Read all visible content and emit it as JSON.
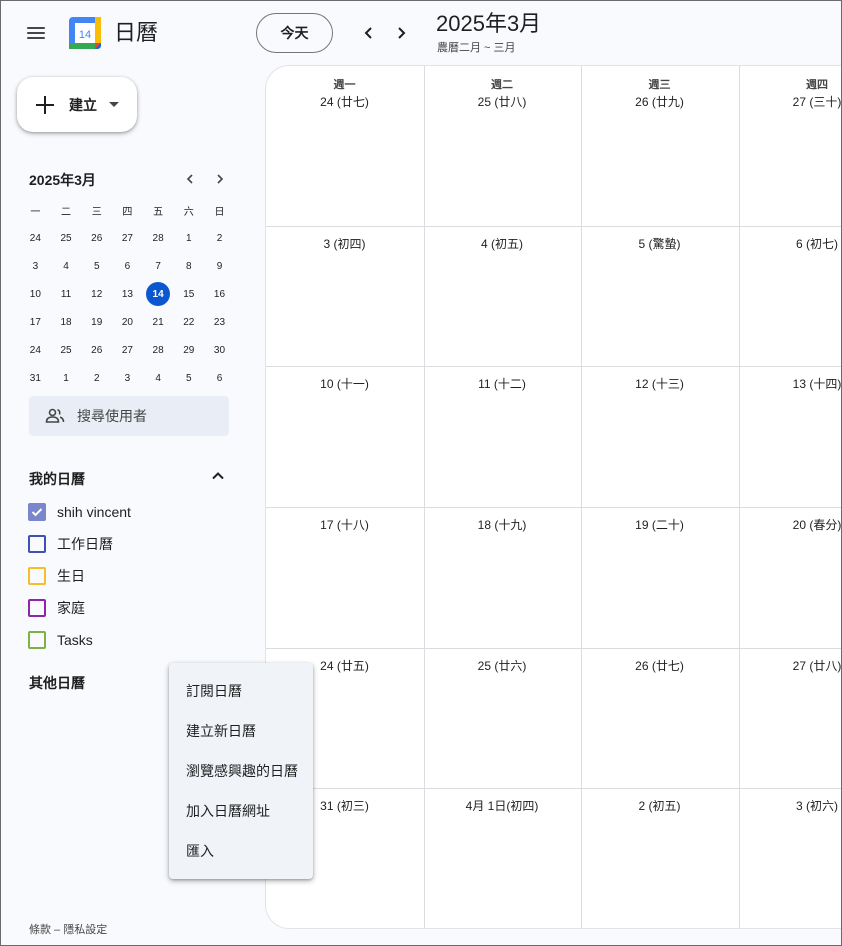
{
  "header": {
    "app_title": "日曆",
    "logo_number": "14",
    "today_button": "今天",
    "month_title": "2025年3月",
    "lunar_range": "農曆二月 ~ 三月"
  },
  "sidebar": {
    "create_label": "建立",
    "mini_calendar": {
      "title": "2025年3月",
      "weekdays": [
        "一",
        "二",
        "三",
        "四",
        "五",
        "六",
        "日"
      ],
      "weeks": [
        [
          "24",
          "25",
          "26",
          "27",
          "28",
          "1",
          "2"
        ],
        [
          "3",
          "4",
          "5",
          "6",
          "7",
          "8",
          "9"
        ],
        [
          "10",
          "11",
          "12",
          "13",
          "14",
          "15",
          "16"
        ],
        [
          "17",
          "18",
          "19",
          "20",
          "21",
          "22",
          "23"
        ],
        [
          "24",
          "25",
          "26",
          "27",
          "28",
          "29",
          "30"
        ],
        [
          "31",
          "1",
          "2",
          "3",
          "4",
          "5",
          "6"
        ]
      ],
      "selected_day": "14"
    },
    "search_people_placeholder": "搜尋使用者",
    "my_calendars_title": "我的日曆",
    "my_calendars": [
      {
        "name": "shih vincent",
        "color": "#7986cb",
        "checked": true
      },
      {
        "name": "工作日曆",
        "color": "#3f51b5",
        "checked": false
      },
      {
        "name": "生日",
        "color": "#f6bf26",
        "checked": false
      },
      {
        "name": "家庭",
        "color": "#8e24aa",
        "checked": false
      },
      {
        "name": "Tasks",
        "color": "#7cb342",
        "checked": false
      }
    ],
    "other_calendars_title": "其他日曆",
    "footer": {
      "terms": "條款",
      "separator": " – ",
      "privacy": "隱私設定"
    }
  },
  "calendar": {
    "weekday_headers": [
      "週一",
      "週二",
      "週三",
      "週四"
    ],
    "weeks": [
      [
        "24 (廿七)",
        "25 (廿八)",
        "26 (廿九)",
        "27 (三十)"
      ],
      [
        "3 (初四)",
        "4 (初五)",
        "5 (驚蟄)",
        "6 (初七)"
      ],
      [
        "10 (十一)",
        "11 (十二)",
        "12 (十三)",
        "13 (十四)"
      ],
      [
        "17 (十八)",
        "18 (十九)",
        "19 (二十)",
        "20 (春分)"
      ],
      [
        "24 (廿五)",
        "25 (廿六)",
        "26 (廿七)",
        "27 (廿八)"
      ],
      [
        "31 (初三)",
        "4月 1日(初四)",
        "2 (初五)",
        "3 (初六)"
      ]
    ]
  },
  "context_menu": {
    "items": [
      "訂閱日曆",
      "建立新日曆",
      "瀏覽感興趣的日曆",
      "加入日曆網址",
      "匯入"
    ]
  },
  "colors": {
    "accent": "#0b57d0",
    "background": "#f8fafd"
  }
}
